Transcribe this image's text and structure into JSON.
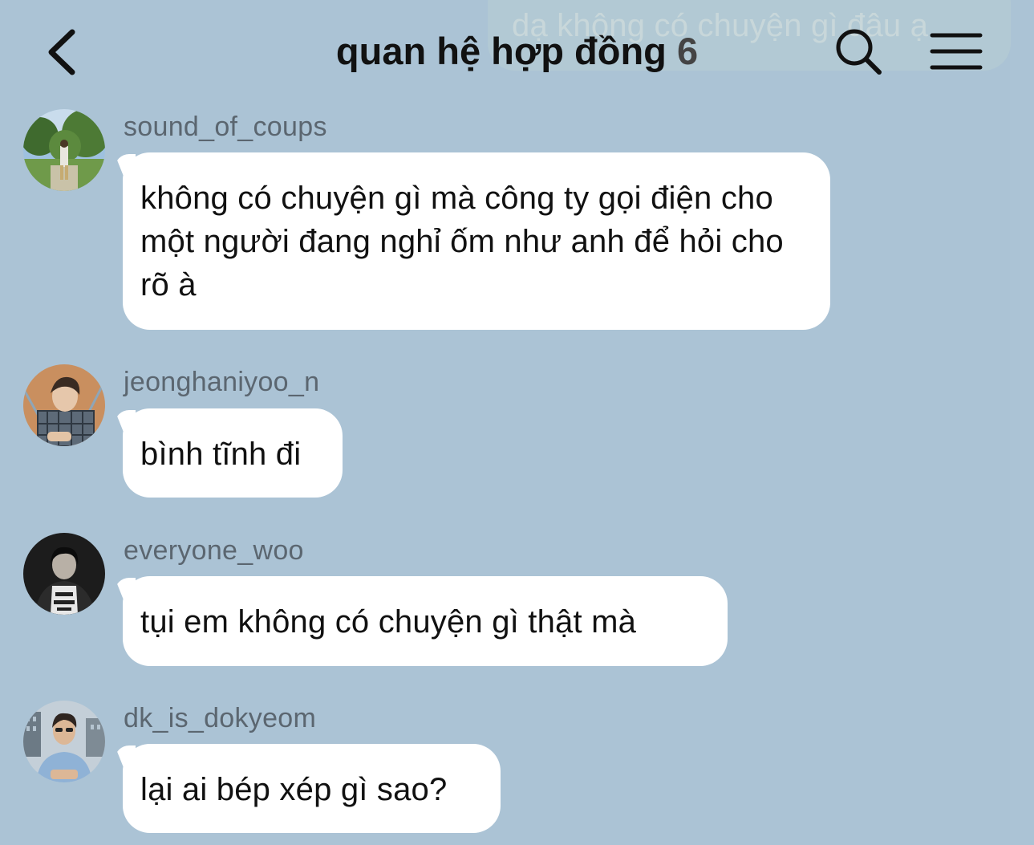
{
  "chat": {
    "title": "quan hệ hợp đồng",
    "member_count": "6",
    "header_overlay_text": "dạ không có chuyện gì đâu ạ"
  },
  "header": {
    "back_icon": "chevron-left-icon",
    "search_icon": "search-icon",
    "menu_icon": "hamburger-menu-icon"
  },
  "colors": {
    "background": "#abc3d5",
    "bubble": "#ffffff",
    "title_text": "#111111",
    "username_text": "#5b6670"
  },
  "messages": [
    {
      "username": "sound_of_coups",
      "text": "không có chuyện gì mà công ty gọi điện cho một người đang nghỉ ốm như anh để hỏi cho rõ à"
    },
    {
      "username": "jeonghaniyoo_n",
      "text": "bình tĩnh đi"
    },
    {
      "username": "everyone_woo",
      "text": "tụi em không có chuyện gì thật mà"
    },
    {
      "username": "dk_is_dokyeom",
      "text": "lại ai bép xép gì sao?"
    }
  ]
}
